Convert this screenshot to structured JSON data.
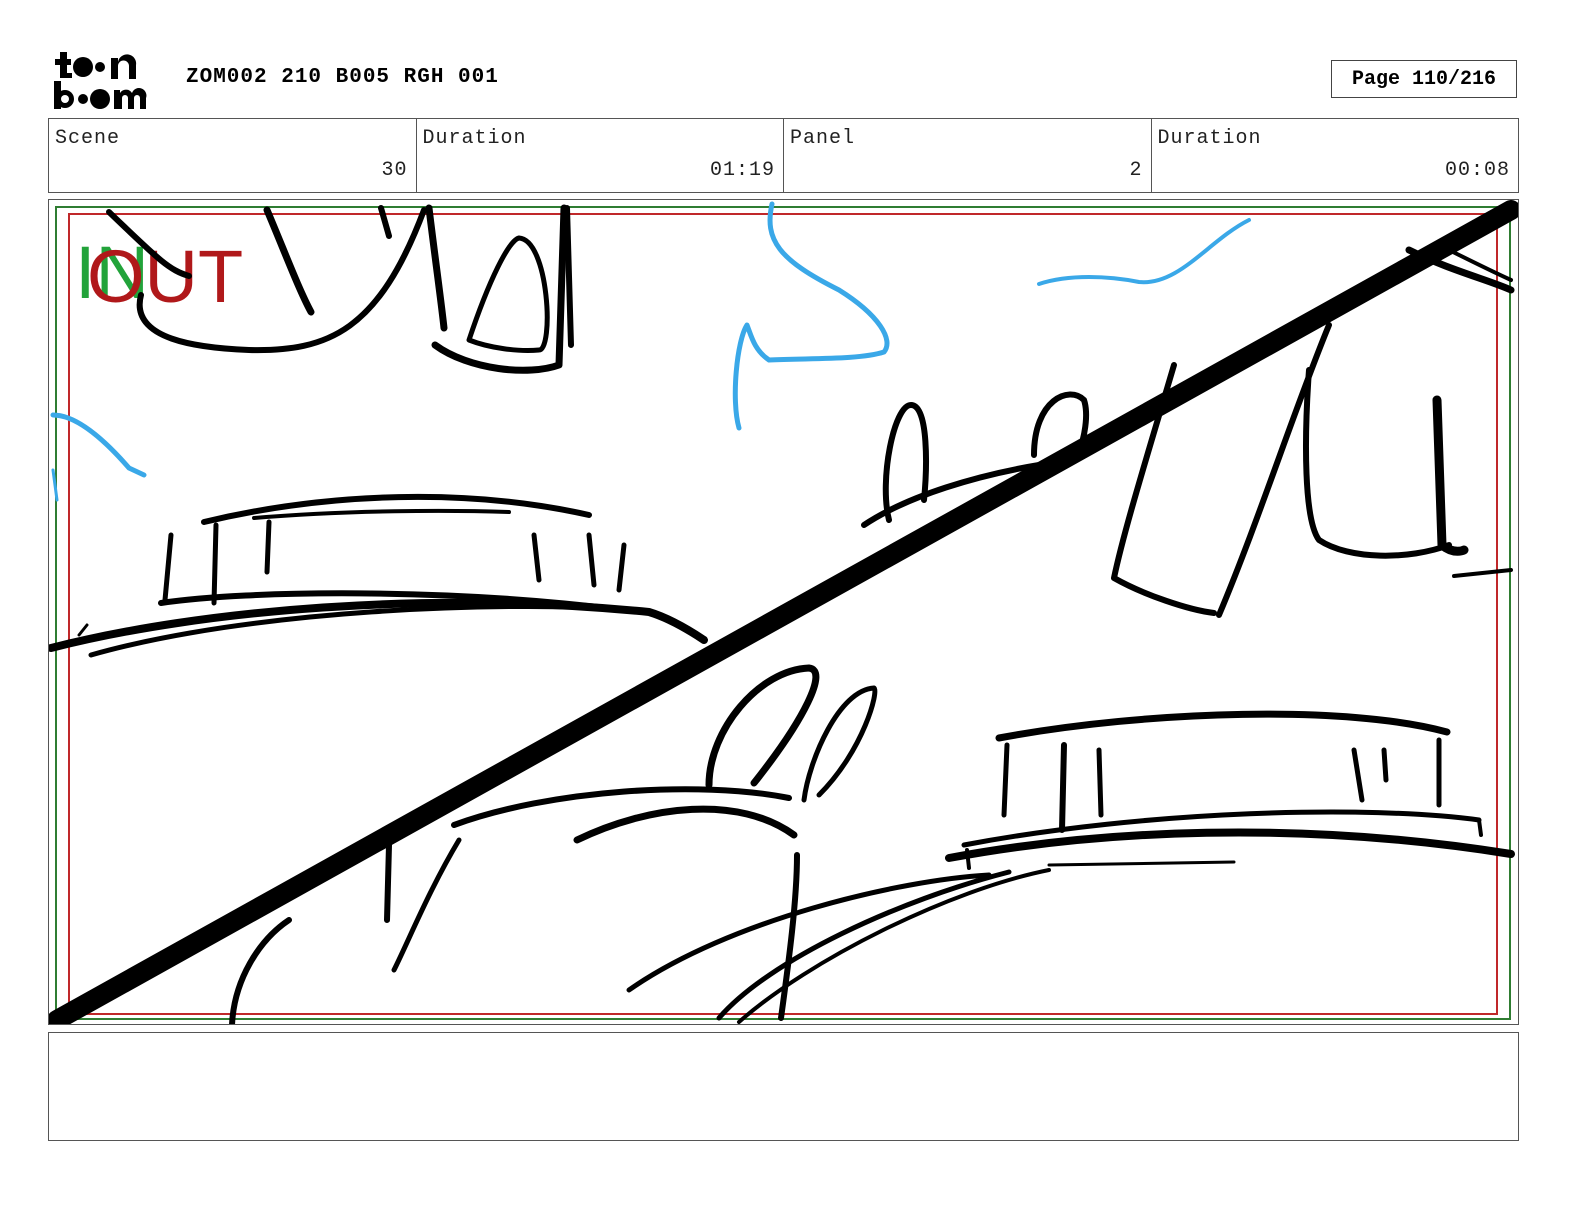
{
  "header": {
    "logo_text": "toon boom",
    "project_title": "ZOM002 210 B005 RGH 001",
    "page_label": "Page 110/216"
  },
  "info": [
    {
      "label": "Scene",
      "value": "30"
    },
    {
      "label": "Duration",
      "value": "01:19"
    },
    {
      "label": "Panel",
      "value": "2"
    },
    {
      "label": "Duration",
      "value": "00:08"
    }
  ],
  "panel": {
    "in_marker": "IN",
    "out_marker": "OUT",
    "colors": {
      "in_marker": "#22a33a",
      "out_marker": "#b0181a",
      "safe_frame_green": "#2f7d32",
      "safe_frame_red": "#c0282a",
      "sketch_blue": "#3aa8e8",
      "sketch_black": "#000000"
    }
  },
  "caption": {
    "text": ""
  }
}
